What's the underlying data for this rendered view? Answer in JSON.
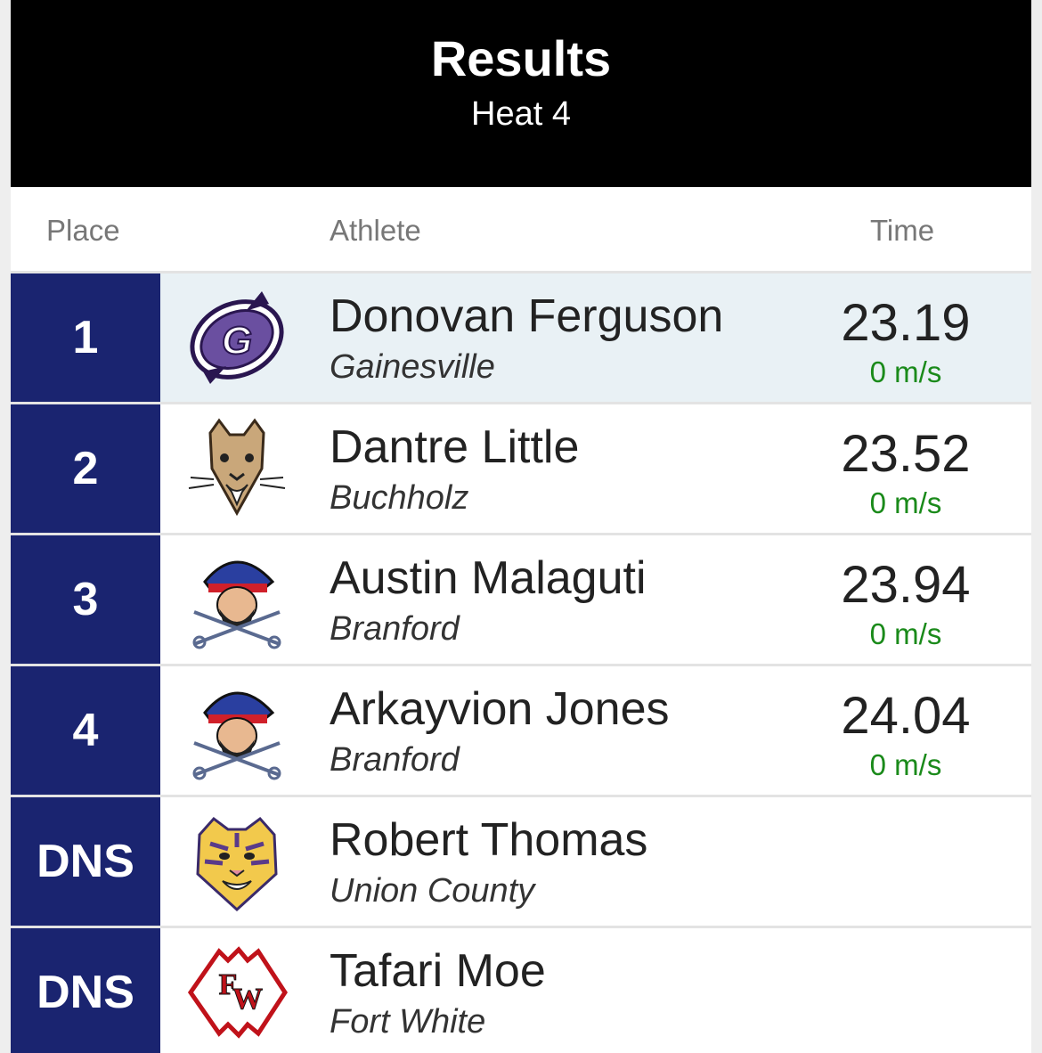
{
  "header": {
    "title": "Results",
    "subtitle": "Heat 4"
  },
  "columns": {
    "place": "Place",
    "athlete": "Athlete",
    "time": "Time"
  },
  "colors": {
    "place_bg": "#1a2470",
    "wind": "#1a8a1a",
    "highlight": "#e9f1f5"
  },
  "rows": [
    {
      "place": "1",
      "name": "Donovan Ferguson",
      "team": "Gainesville",
      "time": "23.19",
      "wind": "0 m/s",
      "logo_icon": "gainesville-logo-icon"
    },
    {
      "place": "2",
      "name": "Dantre Little",
      "team": "Buchholz",
      "time": "23.52",
      "wind": "0 m/s",
      "logo_icon": "bobcat-logo-icon"
    },
    {
      "place": "3",
      "name": "Austin Malaguti",
      "team": "Branford",
      "time": "23.94",
      "wind": "0 m/s",
      "logo_icon": "pirate-logo-icon"
    },
    {
      "place": "4",
      "name": "Arkayvion Jones",
      "team": "Branford",
      "time": "24.04",
      "wind": "0 m/s",
      "logo_icon": "pirate-logo-icon"
    },
    {
      "place": "DNS",
      "name": "Robert Thomas",
      "team": "Union County",
      "time": "",
      "wind": "",
      "logo_icon": "tiger-logo-icon"
    },
    {
      "place": "DNS",
      "name": "Tafari Moe",
      "team": "Fort White",
      "time": "",
      "wind": "",
      "logo_icon": "arrowhead-logo-icon"
    }
  ]
}
